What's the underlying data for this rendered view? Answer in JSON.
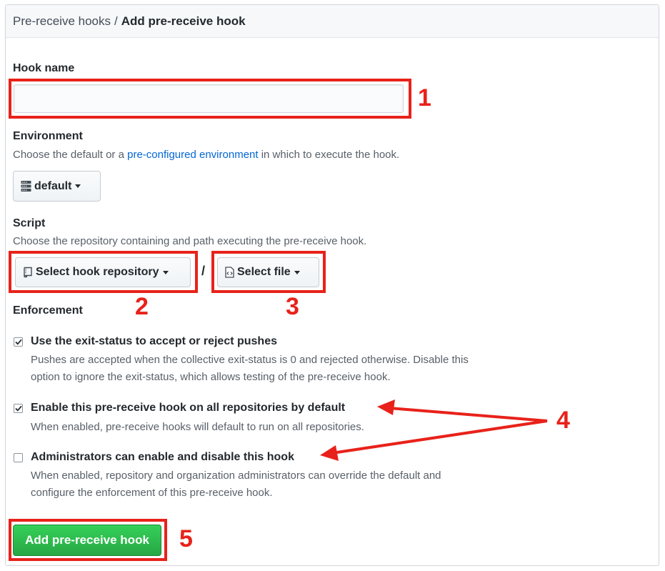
{
  "breadcrumb": {
    "parent": "Pre-receive hooks",
    "separator": "/",
    "current": "Add pre-receive hook"
  },
  "hook_name": {
    "label": "Hook name",
    "value": "",
    "placeholder": ""
  },
  "environment": {
    "label": "Environment",
    "note_before": "Choose the default or a ",
    "link": "pre-configured environment",
    "note_after": " in which to execute the hook.",
    "selected": "default"
  },
  "script": {
    "label": "Script",
    "note": "Choose the repository containing and path executing the pre-receive hook.",
    "repo_button": "Select hook repository",
    "separator": "/",
    "file_button": "Select file"
  },
  "enforcement": {
    "label": "Enforcement",
    "options": [
      {
        "label": "Use the exit-status to accept or reject pushes",
        "note_line1": "Pushes are accepted when the collective exit-status is 0 and rejected otherwise. Disable this",
        "note_line2": "option to ignore the exit-status, which allows testing of the pre-receive hook.",
        "checked": true
      },
      {
        "label": "Enable this pre-receive hook on all repositories by default",
        "note_line1": "When enabled, pre-receive hooks will default to run on all repositories.",
        "checked": true
      },
      {
        "label": "Administrators can enable and disable this hook",
        "note_line1": "When enabled, repository and organization administrators can override the default and",
        "note_line2": "configure the enforcement of this pre-receive hook.",
        "checked": false
      }
    ]
  },
  "submit_label": "Add pre-receive hook",
  "annotations": [
    "1",
    "2",
    "3",
    "4",
    "5"
  ],
  "colors": {
    "annotation_red": "#e8221a",
    "primary_green": "#28a745",
    "link_blue": "#0366d6"
  },
  "icons": [
    "server-icon",
    "repo-icon",
    "file-code-icon",
    "checkmark-icon",
    "caret-down-icon"
  ]
}
